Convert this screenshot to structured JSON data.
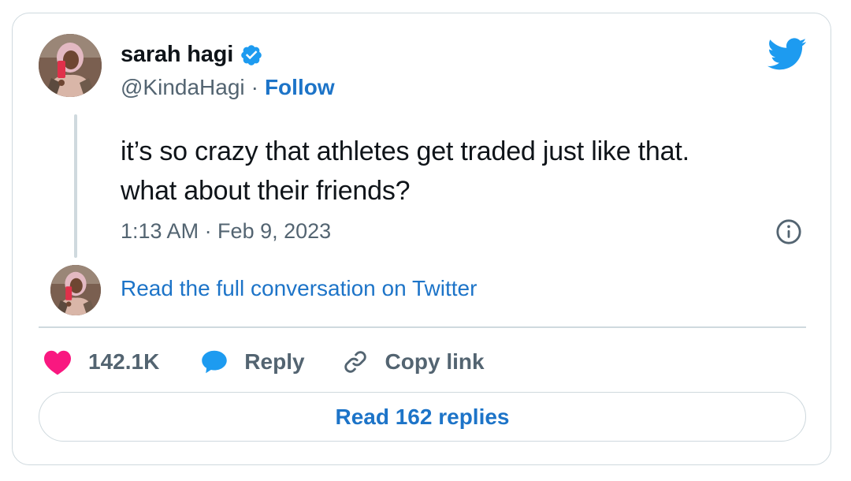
{
  "author": {
    "display_name": "sarah hagi",
    "handle": "@KindaHagi",
    "separator": "·",
    "follow_label": "Follow",
    "verified": true
  },
  "tweet": {
    "text": "it’s so crazy that athletes get traded just like that.\nwhat about their friends?",
    "timestamp": "1:13 AM · Feb 9, 2023"
  },
  "conversation_link": "Read the full conversation on Twitter",
  "actions": {
    "like_count": "142.1K",
    "reply_label": "Reply",
    "copy_label": "Copy link"
  },
  "replies_button": "Read 162 replies",
  "icons": {
    "brand": "twitter-bird-icon",
    "verified": "verified-badge-icon",
    "info": "info-icon",
    "like": "heart-icon",
    "reply": "speech-bubble-icon",
    "copy": "link-icon"
  },
  "colors": {
    "link_blue": "#1d74c8",
    "twitter_blue": "#1d9bf0",
    "like_pink": "#f91880",
    "secondary_text": "#536471",
    "border": "#cfd9de"
  }
}
